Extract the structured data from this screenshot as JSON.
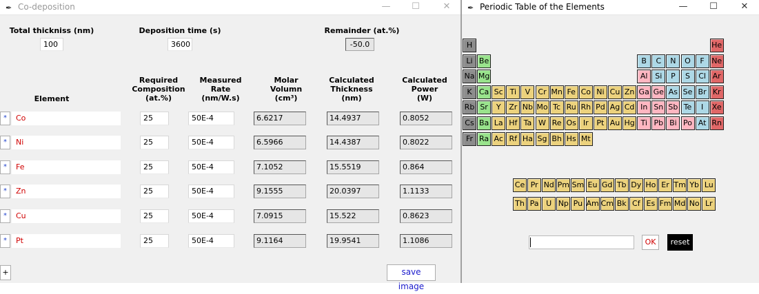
{
  "codeposition": {
    "title": "Co-deposition",
    "total_thickness_label": "Total thickniss (nm)",
    "total_thickness_value": "100",
    "deposition_time_label": "Deposition time (s)",
    "deposition_time_value": "3600",
    "remainder_label": "Remainder (at.%)",
    "remainder_value": "-50.0",
    "headers": {
      "element": "Element",
      "composition": [
        "Required",
        "Composition",
        "(at.%)"
      ],
      "rate": [
        "Measured",
        "Rate",
        "(nm/W.s)"
      ],
      "molar": [
        "Molar",
        "Volumn",
        "(cm³)"
      ],
      "thickness": [
        "Calculated",
        "Thickness",
        "(nm)"
      ],
      "power": [
        "Calculated",
        "Power",
        "(W)"
      ]
    },
    "rows": [
      {
        "star": "*",
        "element": "Co",
        "composition": "25",
        "rate": "50E-4",
        "molar": "6.6217",
        "thickness": "14.4937",
        "power": "0.8052"
      },
      {
        "star": "*",
        "element": "Ni",
        "composition": "25",
        "rate": "50E-4",
        "molar": "6.5966",
        "thickness": "14.4387",
        "power": "0.8022"
      },
      {
        "star": "*",
        "element": "Fe",
        "composition": "25",
        "rate": "50E-4",
        "molar": "7.1052",
        "thickness": "15.5519",
        "power": "0.864"
      },
      {
        "star": "*",
        "element": "Zn",
        "composition": "25",
        "rate": "50E-4",
        "molar": "9.1555",
        "thickness": "20.0397",
        "power": "1.1133"
      },
      {
        "star": "*",
        "element": "Cu",
        "composition": "25",
        "rate": "50E-4",
        "molar": "7.0915",
        "thickness": "15.522",
        "power": "0.8623"
      },
      {
        "star": "*",
        "element": "Pt",
        "composition": "25",
        "rate": "50E-4",
        "molar": "9.1164",
        "thickness": "19.9541",
        "power": "1.1086"
      }
    ],
    "add_label": "+",
    "save_label": "save image"
  },
  "periodic": {
    "title": "Periodic Table of the Elements",
    "ok_label": "OK",
    "reset_label": "reset",
    "input_value": "",
    "colors": {
      "gray": "#8c8c8c",
      "red": "#e06767",
      "green": "#99e38c",
      "yellow": "#ecd27d",
      "blue": "#add8e6",
      "pink": "#ffb6c1"
    },
    "main": [
      {
        "s": "H",
        "c": "gray",
        "col": 0,
        "row": 0
      },
      {
        "s": "He",
        "c": "red",
        "col": 17,
        "row": 0
      },
      {
        "s": "Li",
        "c": "gray",
        "col": 0,
        "row": 1
      },
      {
        "s": "Be",
        "c": "green",
        "col": 1,
        "row": 1
      },
      {
        "s": "B",
        "c": "blue",
        "col": 12,
        "row": 1
      },
      {
        "s": "C",
        "c": "blue",
        "col": 13,
        "row": 1
      },
      {
        "s": "N",
        "c": "blue",
        "col": 14,
        "row": 1
      },
      {
        "s": "O",
        "c": "blue",
        "col": 15,
        "row": 1
      },
      {
        "s": "F",
        "c": "blue",
        "col": 16,
        "row": 1
      },
      {
        "s": "Ne",
        "c": "red",
        "col": 17,
        "row": 1
      },
      {
        "s": "Na",
        "c": "gray",
        "col": 0,
        "row": 2
      },
      {
        "s": "Mg",
        "c": "green",
        "col": 1,
        "row": 2
      },
      {
        "s": "Al",
        "c": "pink",
        "col": 12,
        "row": 2
      },
      {
        "s": "Si",
        "c": "blue",
        "col": 13,
        "row": 2
      },
      {
        "s": "P",
        "c": "blue",
        "col": 14,
        "row": 2
      },
      {
        "s": "S",
        "c": "blue",
        "col": 15,
        "row": 2
      },
      {
        "s": "Cl",
        "c": "blue",
        "col": 16,
        "row": 2
      },
      {
        "s": "Ar",
        "c": "red",
        "col": 17,
        "row": 2
      },
      {
        "s": "K",
        "c": "gray",
        "col": 0,
        "row": 3
      },
      {
        "s": "Ca",
        "c": "green",
        "col": 1,
        "row": 3
      },
      {
        "s": "Sc",
        "c": "yellow",
        "col": 2,
        "row": 3
      },
      {
        "s": "Ti",
        "c": "yellow",
        "col": 3,
        "row": 3
      },
      {
        "s": "V",
        "c": "yellow",
        "col": 4,
        "row": 3
      },
      {
        "s": "Cr",
        "c": "yellow",
        "col": 5,
        "row": 3
      },
      {
        "s": "Mn",
        "c": "yellow",
        "col": 6,
        "row": 3
      },
      {
        "s": "Fe",
        "c": "yellow",
        "col": 7,
        "row": 3
      },
      {
        "s": "Co",
        "c": "yellow",
        "col": 8,
        "row": 3
      },
      {
        "s": "Ni",
        "c": "yellow",
        "col": 9,
        "row": 3
      },
      {
        "s": "Cu",
        "c": "yellow",
        "col": 10,
        "row": 3
      },
      {
        "s": "Zn",
        "c": "yellow",
        "col": 11,
        "row": 3
      },
      {
        "s": "Ga",
        "c": "pink",
        "col": 12,
        "row": 3
      },
      {
        "s": "Ge",
        "c": "pink",
        "col": 13,
        "row": 3
      },
      {
        "s": "As",
        "c": "blue",
        "col": 14,
        "row": 3
      },
      {
        "s": "Se",
        "c": "blue",
        "col": 15,
        "row": 3
      },
      {
        "s": "Br",
        "c": "blue",
        "col": 16,
        "row": 3
      },
      {
        "s": "Kr",
        "c": "red",
        "col": 17,
        "row": 3
      },
      {
        "s": "Rb",
        "c": "gray",
        "col": 0,
        "row": 4
      },
      {
        "s": "Sr",
        "c": "green",
        "col": 1,
        "row": 4
      },
      {
        "s": "Y",
        "c": "yellow",
        "col": 2,
        "row": 4
      },
      {
        "s": "Zr",
        "c": "yellow",
        "col": 3,
        "row": 4
      },
      {
        "s": "Nb",
        "c": "yellow",
        "col": 4,
        "row": 4
      },
      {
        "s": "Mo",
        "c": "yellow",
        "col": 5,
        "row": 4
      },
      {
        "s": "Tc",
        "c": "yellow",
        "col": 6,
        "row": 4
      },
      {
        "s": "Ru",
        "c": "yellow",
        "col": 7,
        "row": 4
      },
      {
        "s": "Rh",
        "c": "yellow",
        "col": 8,
        "row": 4
      },
      {
        "s": "Pd",
        "c": "yellow",
        "col": 9,
        "row": 4
      },
      {
        "s": "Ag",
        "c": "yellow",
        "col": 10,
        "row": 4
      },
      {
        "s": "Cd",
        "c": "yellow",
        "col": 11,
        "row": 4
      },
      {
        "s": "In",
        "c": "pink",
        "col": 12,
        "row": 4
      },
      {
        "s": "Sn",
        "c": "pink",
        "col": 13,
        "row": 4
      },
      {
        "s": "Sb",
        "c": "pink",
        "col": 14,
        "row": 4
      },
      {
        "s": "Te",
        "c": "blue",
        "col": 15,
        "row": 4
      },
      {
        "s": "I",
        "c": "blue",
        "col": 16,
        "row": 4
      },
      {
        "s": "Xe",
        "c": "red",
        "col": 17,
        "row": 4
      },
      {
        "s": "Cs",
        "c": "gray",
        "col": 0,
        "row": 5
      },
      {
        "s": "Ba",
        "c": "green",
        "col": 1,
        "row": 5
      },
      {
        "s": "La",
        "c": "yellow",
        "col": 2,
        "row": 5
      },
      {
        "s": "Hf",
        "c": "yellow",
        "col": 3,
        "row": 5
      },
      {
        "s": "Ta",
        "c": "yellow",
        "col": 4,
        "row": 5
      },
      {
        "s": "W",
        "c": "yellow",
        "col": 5,
        "row": 5
      },
      {
        "s": "Re",
        "c": "yellow",
        "col": 6,
        "row": 5
      },
      {
        "s": "Os",
        "c": "yellow",
        "col": 7,
        "row": 5
      },
      {
        "s": "Ir",
        "c": "yellow",
        "col": 8,
        "row": 5
      },
      {
        "s": "Pt",
        "c": "yellow",
        "col": 9,
        "row": 5
      },
      {
        "s": "Au",
        "c": "yellow",
        "col": 10,
        "row": 5
      },
      {
        "s": "Hg",
        "c": "yellow",
        "col": 11,
        "row": 5
      },
      {
        "s": "Ti",
        "c": "pink",
        "col": 12,
        "row": 5
      },
      {
        "s": "Pb",
        "c": "pink",
        "col": 13,
        "row": 5
      },
      {
        "s": "Bi",
        "c": "pink",
        "col": 14,
        "row": 5
      },
      {
        "s": "Po",
        "c": "pink",
        "col": 15,
        "row": 5
      },
      {
        "s": "At",
        "c": "blue",
        "col": 16,
        "row": 5
      },
      {
        "s": "Rn",
        "c": "red",
        "col": 17,
        "row": 5
      },
      {
        "s": "Fr",
        "c": "gray",
        "col": 0,
        "row": 6
      },
      {
        "s": "Ra",
        "c": "green",
        "col": 1,
        "row": 6
      },
      {
        "s": "Ac",
        "c": "yellow",
        "col": 2,
        "row": 6
      },
      {
        "s": "Rf",
        "c": "yellow",
        "col": 3,
        "row": 6
      },
      {
        "s": "Ha",
        "c": "yellow",
        "col": 4,
        "row": 6
      },
      {
        "s": "Sg",
        "c": "yellow",
        "col": 5,
        "row": 6
      },
      {
        "s": "Bh",
        "c": "yellow",
        "col": 6,
        "row": 6
      },
      {
        "s": "Hs",
        "c": "yellow",
        "col": 7,
        "row": 6
      },
      {
        "s": "Mt",
        "c": "yellow",
        "col": 8,
        "row": 6
      }
    ],
    "lanthanides": [
      "Ce",
      "Pr",
      "Nd",
      "Pm",
      "Sm",
      "Eu",
      "Gd",
      "Tb",
      "Dy",
      "Ho",
      "Er",
      "Tm",
      "Yb",
      "Lu"
    ],
    "actinides": [
      "Th",
      "Pa",
      "U",
      "Np",
      "Pu",
      "Am",
      "Cm",
      "Bk",
      "Cf",
      "Es",
      "Fm",
      "Md",
      "No",
      "Lr"
    ]
  }
}
